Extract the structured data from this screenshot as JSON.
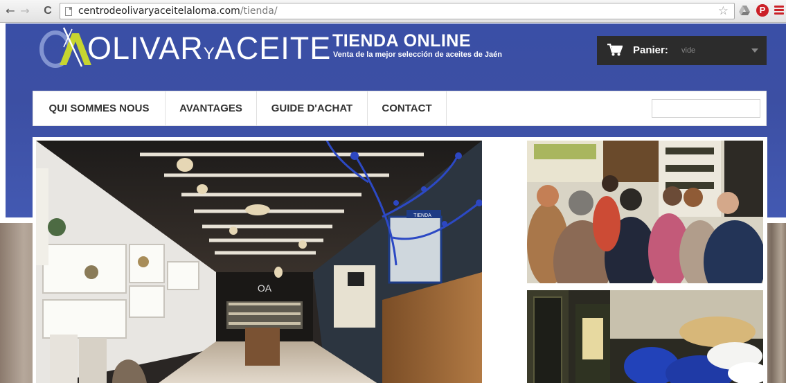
{
  "browser": {
    "back_glyph": "←",
    "forward_glyph": "→",
    "reload_glyph": "C",
    "url_host": "centrodeolivaryaceitelaloma.com",
    "url_path": "/tienda/",
    "star_glyph": "☆",
    "extensions": [
      "drive-icon",
      "pinterest-icon",
      "menu-icon"
    ],
    "pinterest_glyph": "P"
  },
  "site": {
    "logo": {
      "word1": "OLIVAR",
      "connector": "Y",
      "word2": "ACEITE",
      "mark": "OA"
    },
    "title": "TIENDA ONLINE",
    "subtitle": "Venta de la mejor selección de aceites de Jaén"
  },
  "cart": {
    "label": "Panier:",
    "value": "vide"
  },
  "nav": {
    "items": [
      {
        "label": "QUI SOMMES NOUS"
      },
      {
        "label": "AVANTAGES"
      },
      {
        "label": "GUIDE D'ACHAT"
      },
      {
        "label": "CONTACT"
      }
    ],
    "search_value": ""
  },
  "photos": {
    "main": {
      "alt": "interior de la tienda",
      "sign": "TIENDA",
      "wall_logo": "OA"
    },
    "top_right": {
      "alt": "visitantes en la tienda"
    },
    "bottom_right": {
      "alt": "cata de aceite"
    }
  },
  "colors": {
    "header_blue": "#3c50a6",
    "cart_dark": "#2c2c2c",
    "logo_green": "#c7d530",
    "pinterest_red": "#cb2027"
  }
}
